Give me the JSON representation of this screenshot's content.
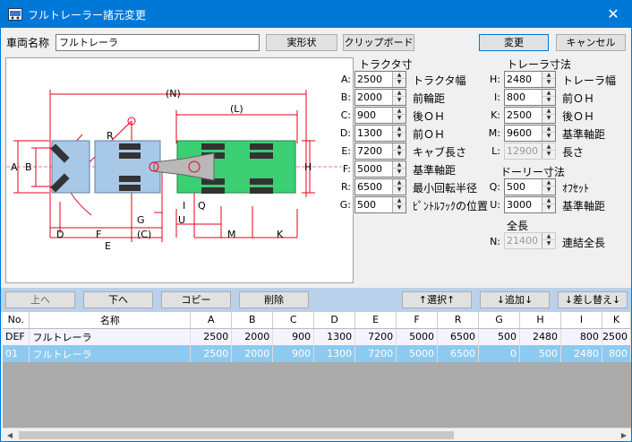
{
  "window": {
    "title": "フルトレーラー諸元変更",
    "close_glyph": "✕"
  },
  "top": {
    "vehicle_name_label": "車両名称",
    "vehicle_name_value": "フルトレーラ",
    "actual_shape_button": "実形状",
    "clipboard_button": "クリップボード",
    "change_button": "変更",
    "cancel_button": "キャンセル"
  },
  "tractor": {
    "heading": "トラクタ寸",
    "rows": [
      {
        "key": "A:",
        "value": "2500",
        "desc": "トラクタ幅"
      },
      {
        "key": "B:",
        "value": "2000",
        "desc": "前輪距"
      },
      {
        "key": "C:",
        "value": "900",
        "desc": "後ＯＨ"
      },
      {
        "key": "D:",
        "value": "1300",
        "desc": "前ＯＨ"
      },
      {
        "key": "E:",
        "value": "7200",
        "desc": "キャブ長さ"
      },
      {
        "key": "F:",
        "value": "5000",
        "desc": "基準軸距"
      },
      {
        "key": "R:",
        "value": "6500",
        "desc": "最小回転半径"
      },
      {
        "key": "G:",
        "value": "500",
        "desc": "ﾋﾟﾝﾄﾙﾌｯｸの位置"
      }
    ]
  },
  "trailer": {
    "heading": "トレーラ寸法",
    "rows": [
      {
        "key": "H:",
        "value": "2480",
        "desc": "トレーラ幅"
      },
      {
        "key": "I:",
        "value": "800",
        "desc": "前ＯＨ"
      },
      {
        "key": "K:",
        "value": "2500",
        "desc": "後ＯＨ"
      },
      {
        "key": "M:",
        "value": "9600",
        "desc": "基準軸距"
      },
      {
        "key": "L:",
        "value": "12900",
        "desc": "長さ"
      }
    ]
  },
  "dolly": {
    "heading": "ドーリー寸法",
    "rows": [
      {
        "key": "Q:",
        "value": "500",
        "desc": "ｵﾌｾｯﾄ"
      },
      {
        "key": "U:",
        "value": "3000",
        "desc": "基準軸距"
      }
    ]
  },
  "total": {
    "heading": "全長",
    "key": "N:",
    "value": "21400",
    "desc": "連結全長"
  },
  "diagram": {
    "labels": {
      "N": "(N)",
      "L": "(L)",
      "R": "R",
      "A": "A",
      "B": "B",
      "H": "H",
      "D": "D",
      "F": "F",
      "C": "(C)",
      "G": "G",
      "E": "E",
      "U": "U",
      "I": "I",
      "Q": "Q",
      "M": "M",
      "K": "K"
    },
    "colors": {
      "tractor": "#a8c8e8",
      "trailer": "#3ccf74",
      "dim": "#e8001c"
    }
  },
  "toolbar": {
    "up": "上へ",
    "down": "下へ",
    "copy": "コピー",
    "delete": "削除",
    "select": "↑選択↑",
    "add": "↓追加↓",
    "replace": "↓差し替え↓"
  },
  "table": {
    "columns": [
      "No.",
      "名称",
      "A",
      "B",
      "C",
      "D",
      "E",
      "F",
      "R",
      "G",
      "H",
      "I",
      "K"
    ],
    "rows": [
      {
        "cells": [
          "DEF",
          "フルトレーラ",
          "2500",
          "2000",
          "900",
          "1300",
          "7200",
          "5000",
          "6500",
          "500",
          "2480",
          "800",
          "2500"
        ]
      },
      {
        "cells": [
          "01",
          "フルトレーラ",
          "2500",
          "2000",
          "900",
          "1300",
          "7200",
          "5000",
          "6500",
          "0",
          "500",
          "2480",
          "800"
        ]
      }
    ]
  }
}
